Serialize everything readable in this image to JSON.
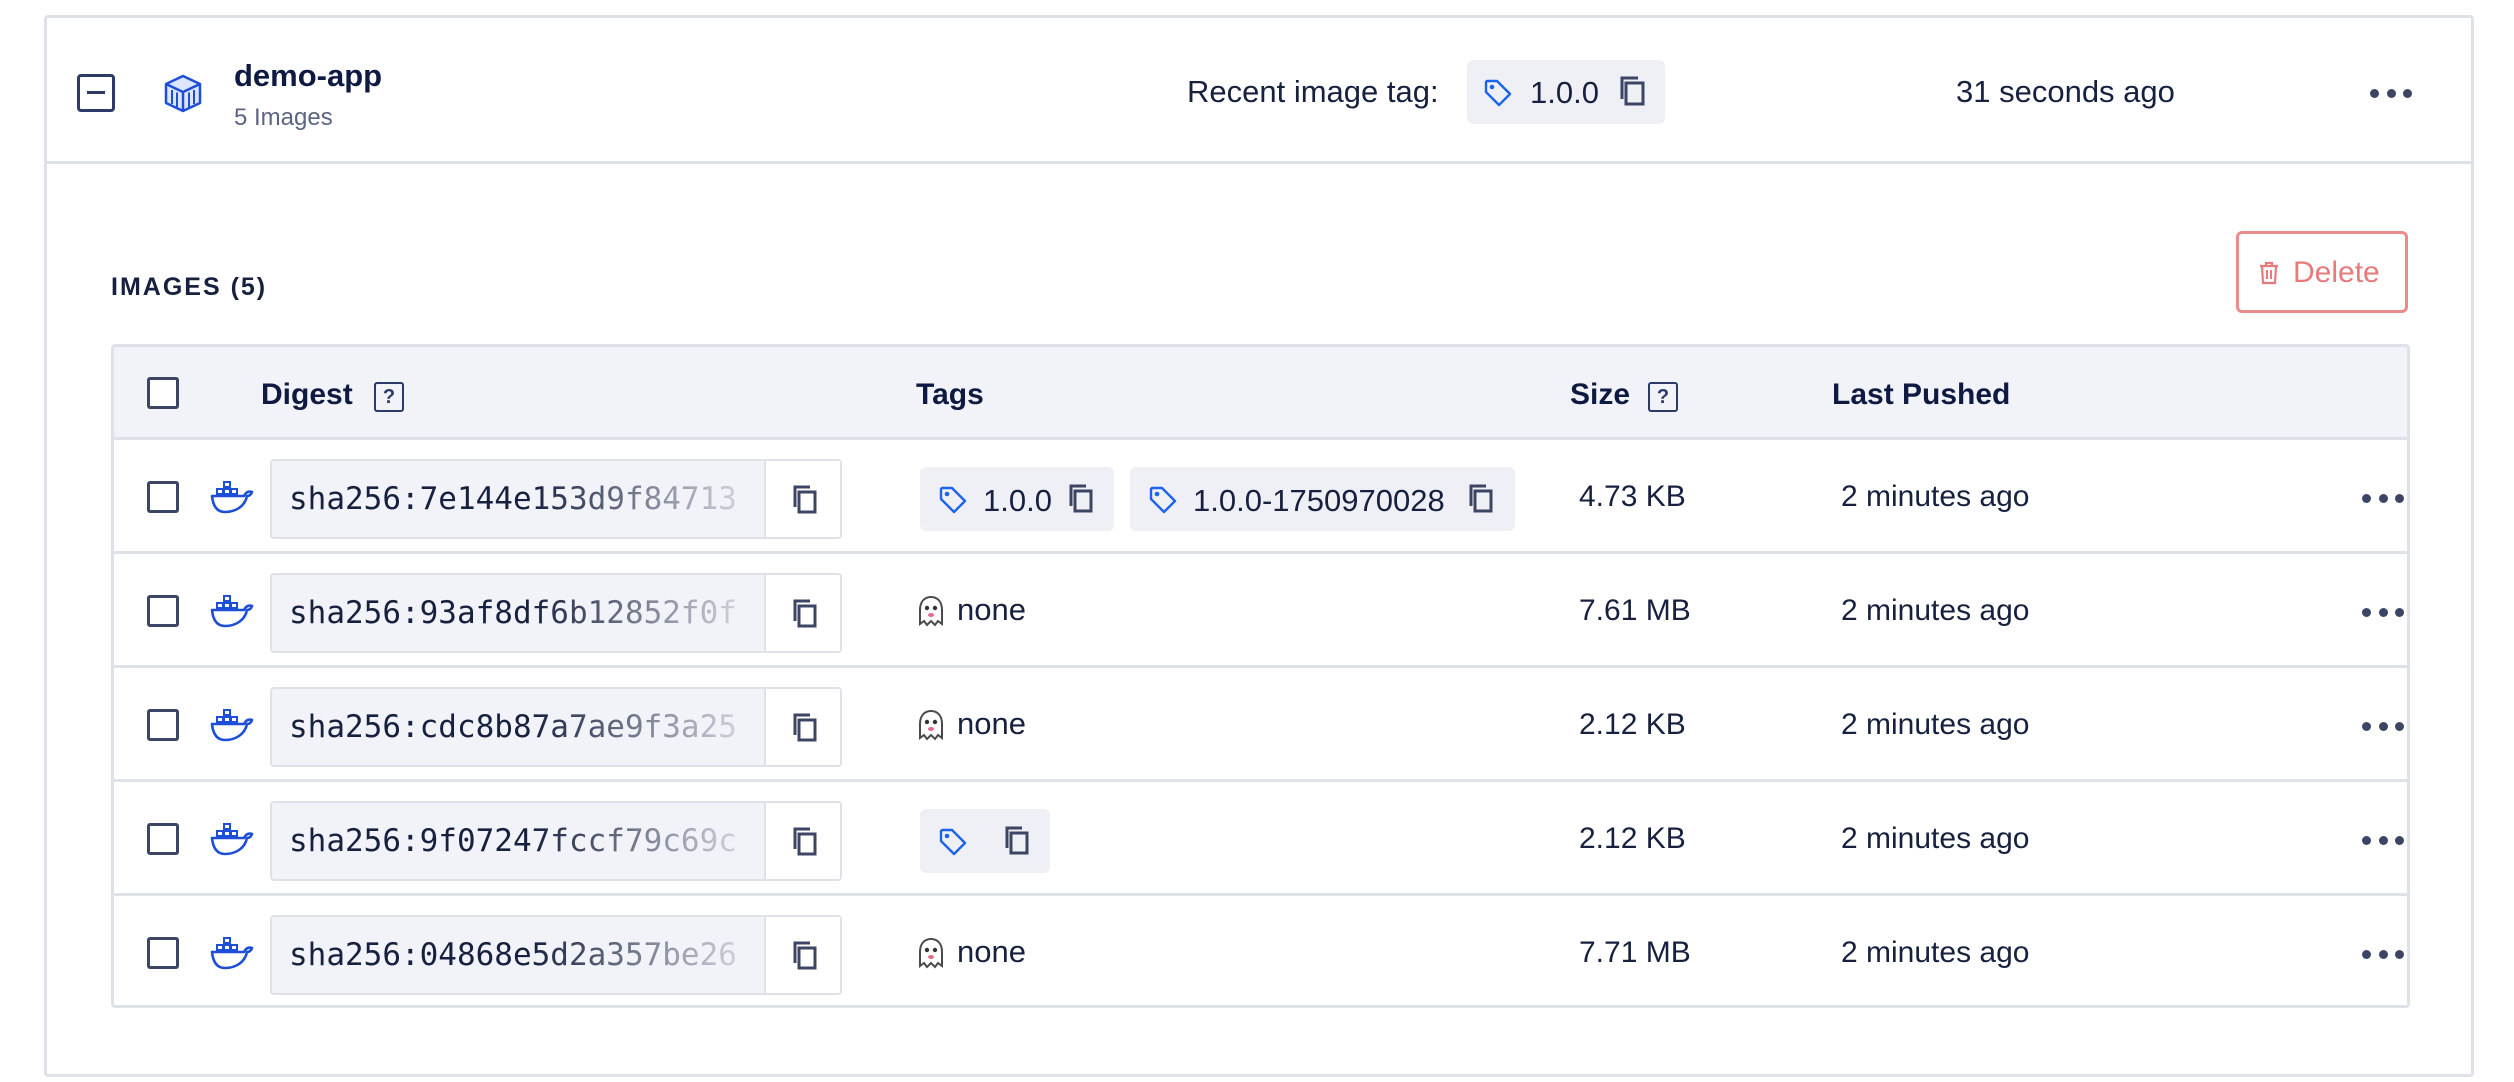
{
  "repository": {
    "name": "demo-app",
    "image_count": "5 Images",
    "recent_tag_label": "Recent image tag:",
    "recent_tag": "1.0.0",
    "updated": "31 seconds ago",
    "icons": {
      "collapse": "minus-square-icon",
      "repo": "container-box-icon",
      "tag": "tag-icon",
      "copy": "copy-icon",
      "menu": "more-horizontal-icon"
    }
  },
  "images_section": {
    "title": "IMAGES (5)",
    "delete_label": "Delete"
  },
  "table": {
    "headers": {
      "digest": "Digest",
      "tags": "Tags",
      "size": "Size",
      "last_pushed": "Last Pushed",
      "help": "?"
    },
    "rows": [
      {
        "digest": "sha256:7e144e153d9f84713",
        "tags": [
          "1.0.0",
          "1.0.0-1750970028"
        ],
        "size": "4.73 KB",
        "last_pushed": "2 minutes ago"
      },
      {
        "digest": "sha256:93af8df6b12852f0f",
        "tags": [],
        "untagged": "none",
        "size": "7.61 MB",
        "last_pushed": "2 minutes ago"
      },
      {
        "digest": "sha256:cdc8b87a7ae9f3a25",
        "tags": [],
        "untagged": "none",
        "size": "2.12 KB",
        "last_pushed": "2 minutes ago"
      },
      {
        "digest": "sha256:9f07247fccf79c69c",
        "tags": [
          ""
        ],
        "size": "2.12 KB",
        "last_pushed": "2 minutes ago"
      },
      {
        "digest": "sha256:04868e5d2a357be26",
        "tags": [],
        "untagged": "none",
        "size": "7.71 MB",
        "last_pushed": "2 minutes ago"
      }
    ]
  },
  "colors": {
    "text": "#07113b",
    "border": "#dfe1e8",
    "header_bg": "#f2f3f8",
    "accent_blue": "#1d63ed",
    "danger": "#e77b7b"
  }
}
